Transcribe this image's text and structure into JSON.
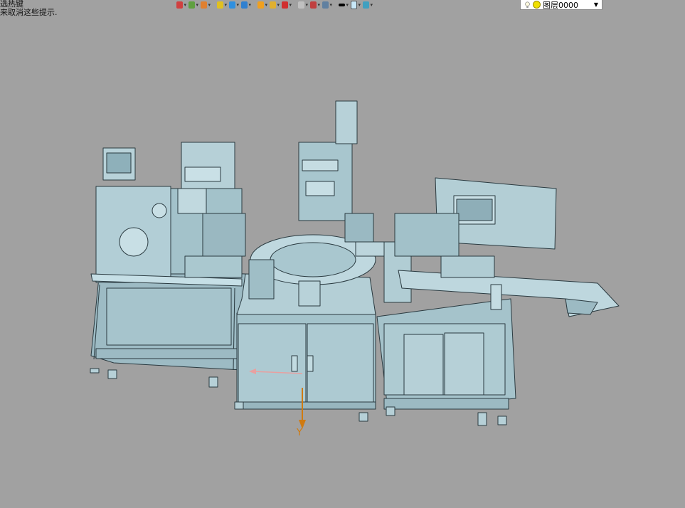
{
  "prompt": {
    "line1": "选热键",
    "line2": "来取消这些提示."
  },
  "toolbar": {
    "icons": [
      {
        "name": "undo-icon",
        "color": "#d04040"
      },
      {
        "name": "texture-icon",
        "color": "#60a040"
      },
      {
        "name": "pencil-icon",
        "color": "#e08030"
      },
      {
        "name": "box-yellow-icon",
        "color": "#e0c020"
      },
      {
        "name": "cube-blue-icon",
        "color": "#3090e0"
      },
      {
        "name": "cube-multi-icon",
        "color": "#3080d0"
      },
      {
        "name": "sphere-orange-icon",
        "color": "#f0a020"
      },
      {
        "name": "view-frame-icon",
        "color": "#e0b030"
      },
      {
        "name": "coordinate-icon",
        "color": "#d03030"
      },
      {
        "name": "page-icon",
        "color": "#c0c0c0"
      },
      {
        "name": "rotate-icon",
        "color": "#c04040"
      },
      {
        "name": "display-icon",
        "color": "#6080a0"
      },
      {
        "name": "line-color-icon",
        "color": "#000000"
      },
      {
        "name": "fill-color-icon",
        "color": "#c8e8f8"
      },
      {
        "name": "layers-icon",
        "color": "#40a0c0"
      }
    ]
  },
  "layer": {
    "label": "图层0000"
  },
  "viewport": {
    "background": "#a1a1a1",
    "model_color": "#a9c7cf",
    "edge_color": "#2a3a40",
    "axis_y_label": "Y",
    "axis_color": "#d07a10"
  }
}
